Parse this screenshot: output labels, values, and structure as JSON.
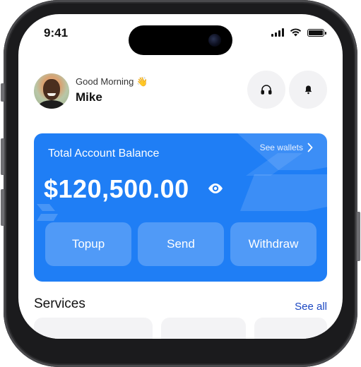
{
  "status_bar": {
    "time": "9:41"
  },
  "header": {
    "greeting": "Good Morning",
    "greeting_emoji": "👋",
    "user_name": "Mike",
    "support_icon": "headphones-icon",
    "notification_icon": "bell-icon"
  },
  "balance_card": {
    "title": "Total Account Balance",
    "see_wallets_label": "See wallets",
    "amount": "$120,500.00",
    "accent_color": "#1f7ef5",
    "actions": [
      {
        "label": "Topup"
      },
      {
        "label": "Send"
      },
      {
        "label": "Withdraw"
      }
    ]
  },
  "services": {
    "title": "Services",
    "see_all_label": "See all"
  },
  "colors": {
    "link": "#1b47c2",
    "button_bg": "#f2f2f4"
  }
}
